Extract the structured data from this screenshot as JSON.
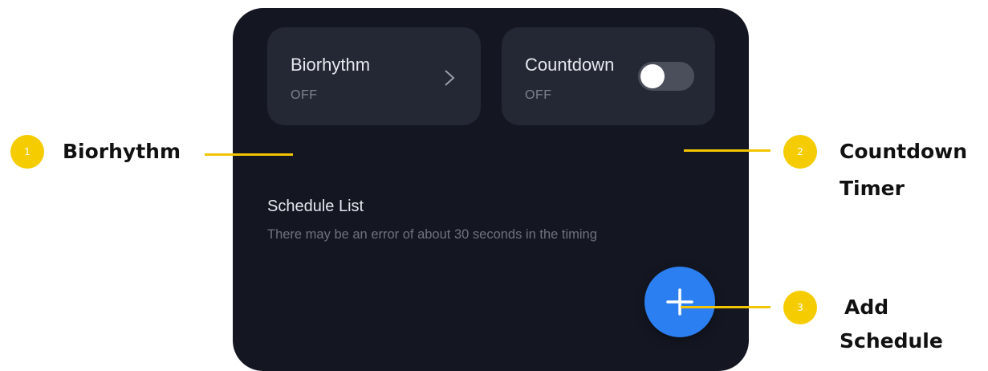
{
  "cards": {
    "biorhythm": {
      "title": "Biorhythm",
      "status": "OFF"
    },
    "countdown": {
      "title": "Countdown",
      "status": "OFF",
      "toggle_on": false
    }
  },
  "schedule": {
    "title": "Schedule List",
    "note": "There may be an error of about 30 seconds in the timing"
  },
  "fab": {
    "icon": "plus-icon"
  },
  "callouts": [
    {
      "number": "1",
      "label": "Biorhythm"
    },
    {
      "number": "2",
      "label_line1": "Countdown",
      "label_line2": "Timer"
    },
    {
      "number": "3",
      "label_line1": "Add",
      "label_line2": "Schedule"
    }
  ],
  "colors": {
    "panel_bg": "#141722",
    "card_bg": "#242835",
    "accent_blue": "#2b7ff0",
    "callout_yellow": "#f5cc00"
  }
}
